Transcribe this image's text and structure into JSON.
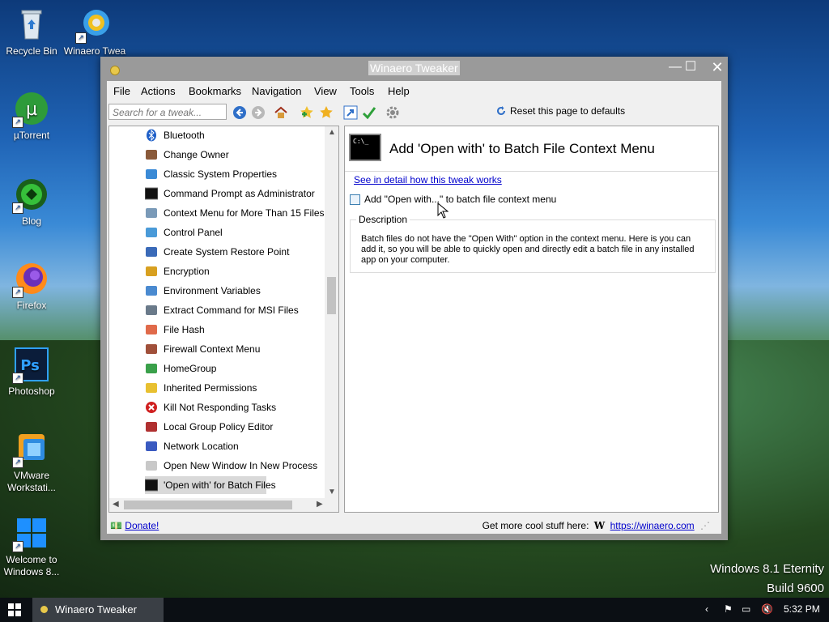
{
  "desktop": {
    "icons": [
      {
        "label": "Recycle Bin",
        "icon": "recycle-bin-icon",
        "shortcut": false
      },
      {
        "label": "Winaero Twea",
        "icon": "winaero-icon",
        "shortcut": true
      },
      {
        "label": "µTorrent",
        "icon": "utorrent-icon",
        "shortcut": true
      },
      {
        "label": "Blog",
        "icon": "blog-icon",
        "shortcut": true
      },
      {
        "label": "Firefox",
        "icon": "firefox-icon",
        "shortcut": true
      },
      {
        "label": "Photoshop",
        "icon": "photoshop-icon",
        "shortcut": true
      },
      {
        "label": "VMware Workstati...",
        "icon": "vmware-icon",
        "shortcut": true
      },
      {
        "label": "Welcome to Windows 8...",
        "icon": "windows-icon",
        "shortcut": true
      }
    ],
    "watermark_line1": "Windows 8.1 Eternity",
    "watermark_line2": "Build 9600"
  },
  "window": {
    "title": "Winaero Tweaker",
    "menu": [
      "File",
      "Actions",
      "Bookmarks",
      "Navigation",
      "View",
      "Tools",
      "Help"
    ],
    "search_placeholder": "Search for a tweak...",
    "reset_label": "Reset this page to defaults",
    "tree": [
      {
        "label": "Bluetooth",
        "icon": "bluetooth-icon"
      },
      {
        "label": "Change Owner",
        "icon": "user-icon"
      },
      {
        "label": "Classic System Properties",
        "icon": "monitor-icon"
      },
      {
        "label": "Command Prompt as Administrator",
        "icon": "cmd-icon"
      },
      {
        "label": "Context Menu for More Than 15 Files",
        "icon": "context-menu-icon"
      },
      {
        "label": "Control Panel",
        "icon": "control-panel-icon"
      },
      {
        "label": "Create System Restore Point",
        "icon": "restore-icon"
      },
      {
        "label": "Encryption",
        "icon": "lock-icon"
      },
      {
        "label": "Environment Variables",
        "icon": "env-icon"
      },
      {
        "label": "Extract Command for MSI Files",
        "icon": "msi-icon"
      },
      {
        "label": "File Hash",
        "icon": "file-hash-icon"
      },
      {
        "label": "Firewall Context Menu",
        "icon": "firewall-icon"
      },
      {
        "label": "HomeGroup",
        "icon": "homegroup-icon"
      },
      {
        "label": "Inherited Permissions",
        "icon": "shield-icon"
      },
      {
        "label": "Kill Not Responding Tasks",
        "icon": "kill-icon"
      },
      {
        "label": "Local Group Policy Editor",
        "icon": "policy-icon"
      },
      {
        "label": "Network Location",
        "icon": "network-icon"
      },
      {
        "label": "Open New Window In New Process",
        "icon": "window-icon"
      },
      {
        "label": "'Open with' for Batch Files",
        "icon": "cmd-icon",
        "selected": true
      }
    ],
    "panel": {
      "title": "Add 'Open with' to Batch File Context Menu",
      "cmd_text": "C:\\_",
      "detail_link": "See in detail how this tweak works",
      "checkbox_label": "Add \"Open with...\" to batch file context menu",
      "checkbox_checked": false,
      "description_legend": "Description",
      "description": "Batch files do not have the \"Open With\" option in the context menu. Here is you can add it, so you will be able to quickly open and directly edit a batch file in any installed app on your computer."
    },
    "status": {
      "donate": "Donate!",
      "more_text": "Get more cool stuff here:",
      "w_logo": "W",
      "url": "https://winaero.com"
    }
  },
  "taskbar": {
    "app_label": "Winaero Tweaker",
    "time": "5:32 PM"
  },
  "colors": {
    "link": "#0000cc",
    "selection": "#d9d9d9",
    "taskbar": "#0b0f14"
  }
}
